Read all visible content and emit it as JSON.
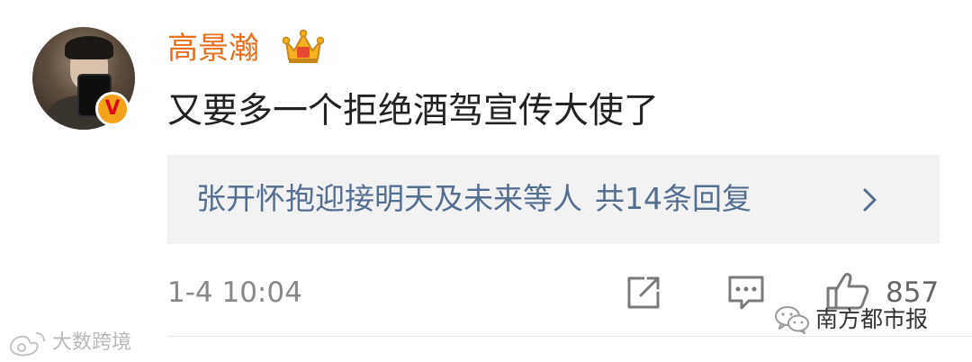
{
  "comment": {
    "username": "高景瀚",
    "text": "又要多一个拒绝酒驾宣传大使了",
    "time": "1-4 10:04",
    "like_count": "857"
  },
  "reply_preview": {
    "users": "张开怀抱迎接明天及未来等人",
    "count": "共14条回复"
  },
  "icons": {
    "badge": "verified-v-icon",
    "crown": "crown-icon",
    "share": "share-icon",
    "reply": "comment-icon",
    "like": "like-icon",
    "chevron": "chevron-right-icon"
  },
  "watermarks": {
    "left": "大数跨境",
    "right": "南方都市报"
  },
  "colors": {
    "username": "#e86e1c",
    "link": "#546e90",
    "reply_bg": "#f2f2f2",
    "badge_bg": "#f3a21b",
    "badge_v": "#d80e12"
  }
}
